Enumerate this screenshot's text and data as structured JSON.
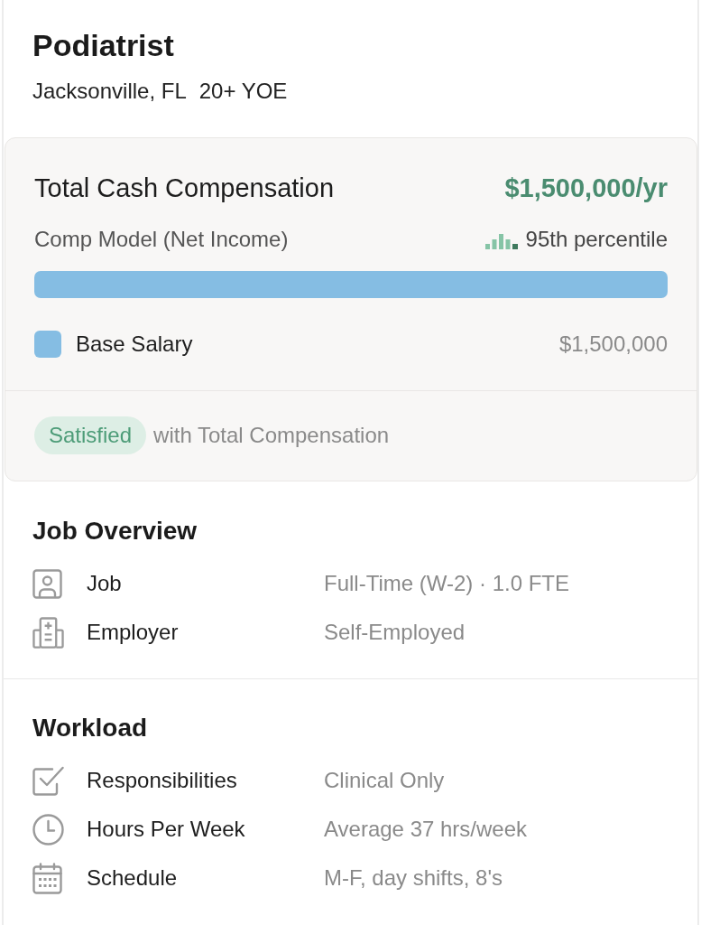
{
  "header": {
    "title": "Podiatrist",
    "location": "Jacksonville, FL",
    "experience": "20+ YOE"
  },
  "compensation": {
    "title": "Total Cash Compensation",
    "total": "$1,500,000/yr",
    "model": "Comp Model (Net Income)",
    "percentile": "95th percentile",
    "segments": [
      {
        "label": "Base Salary",
        "amount": "$1,500,000",
        "color": "#85bde3"
      }
    ],
    "satisfaction": {
      "badge": "Satisfied",
      "text": "with Total Compensation"
    }
  },
  "sections": [
    {
      "title": "Job Overview",
      "rows": [
        {
          "label": "Job",
          "value": "Full-Time (W-2) · 1.0 FTE"
        },
        {
          "label": "Employer",
          "value": "Self-Employed"
        }
      ]
    },
    {
      "title": "Workload",
      "rows": [
        {
          "label": "Responsibilities",
          "value": "Clinical Only"
        },
        {
          "label": "Hours Per Week",
          "value": "Average 37 hrs/week"
        },
        {
          "label": "Schedule",
          "value": "M-F, day shifts, 8's"
        }
      ]
    }
  ]
}
